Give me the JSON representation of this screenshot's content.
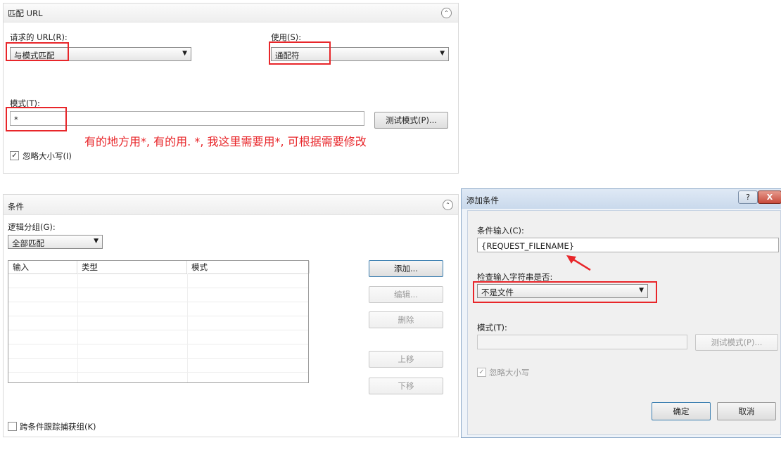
{
  "match_url": {
    "title": "匹配 URL",
    "requested_url_label": "请求的 URL(R):",
    "requested_url_value": "与模式匹配",
    "using_label": "使用(S):",
    "using_value": "通配符",
    "pattern_label": "模式(T):",
    "pattern_value": "*",
    "test_button": "测试模式(P)...",
    "ignore_case_label": "忽略大小写(I)",
    "ignore_case_checked": "✓",
    "annotation": "有的地方用*, 有的用. *, 我这里需要用*, 可根据需要修改"
  },
  "conditions": {
    "title": "条件",
    "logical_group_label": "逻辑分组(G):",
    "logical_group_value": "全部匹配",
    "columns": [
      "输入",
      "类型",
      "模式"
    ],
    "buttons": {
      "add": "添加...",
      "edit": "编辑...",
      "delete": "删除",
      "move_up": "上移",
      "move_down": "下移"
    },
    "track_groups_label": "跨条件跟踪捕获组(K)"
  },
  "add_condition_dialog": {
    "title": "添加条件",
    "help": "?",
    "close": "X",
    "condition_input_label": "条件输入(C):",
    "condition_input_value": "{REQUEST_FILENAME}",
    "check_label": "检查输入字符串是否:",
    "check_value": "不是文件",
    "pattern_label": "模式(T):",
    "pattern_value": "",
    "test_button": "测试模式(P)...",
    "ignore_case_label": "忽略大小写",
    "ignore_case_checked": "✓",
    "ok_button": "确定",
    "cancel_button": "取消"
  },
  "colors": {
    "annotation_red": "#e8262a",
    "close_button_red": "#c94a3b"
  }
}
